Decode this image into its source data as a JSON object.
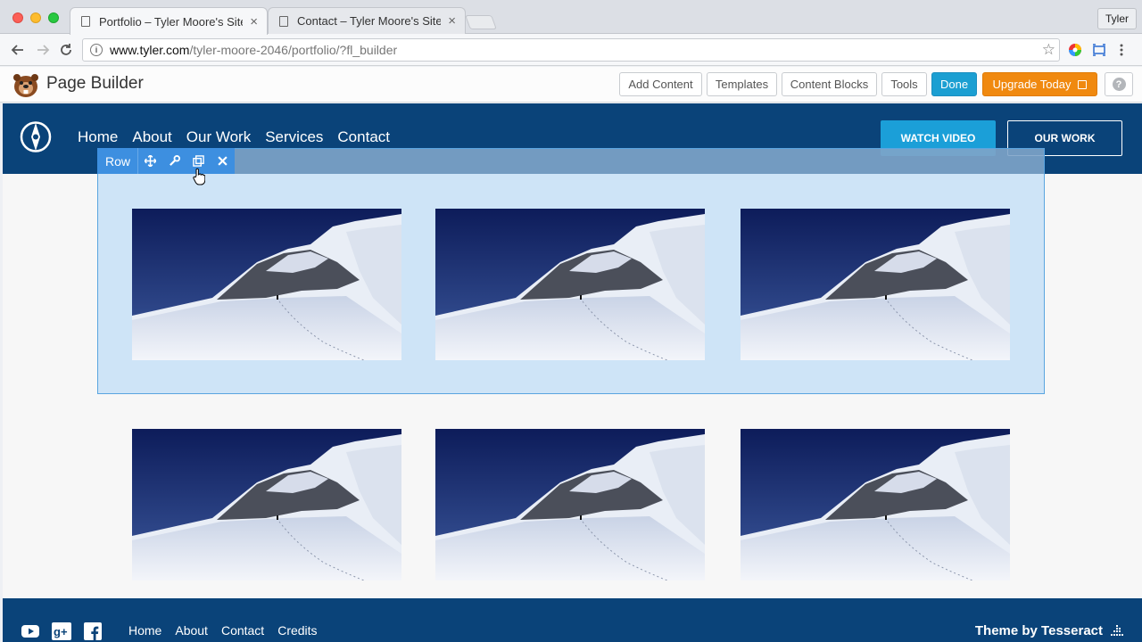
{
  "browser": {
    "tabs": [
      {
        "title": "Portfolio – Tyler Moore's Site",
        "close": "×"
      },
      {
        "title": "Contact – Tyler Moore's Site",
        "close": "×"
      }
    ],
    "profile": "Tyler",
    "url_host": "www.tyler.com",
    "url_path": "/tyler-moore-2046/portfolio/?fl_builder"
  },
  "builder": {
    "title": "Page Builder",
    "buttons": {
      "add_content": "Add Content",
      "templates": "Templates",
      "content_blocks": "Content Blocks",
      "tools": "Tools",
      "done": "Done",
      "upgrade": "Upgrade Today"
    },
    "help": "?"
  },
  "site": {
    "nav": [
      "Home",
      "About",
      "Our Work",
      "Services",
      "Contact"
    ],
    "cta_primary": "WATCH VIDEO",
    "cta_secondary": "OUR WORK"
  },
  "row_toolbar": {
    "label": "Row",
    "icons": [
      "move-icon",
      "wrench-icon",
      "duplicate-icon",
      "close-icon"
    ]
  },
  "gallery": {
    "image_count": 6,
    "image_subject": "snowy-mountain-photo"
  },
  "footer": {
    "social": [
      "youtube-icon",
      "google-plus-icon",
      "facebook-icon"
    ],
    "nav": [
      "Home",
      "About",
      "Contact",
      "Credits"
    ],
    "credit": "Theme by Tesseract"
  },
  "colors": {
    "site_header": "#0a4379",
    "builder_done": "#1b9fd2",
    "builder_upgrade": "#f0890f",
    "row_selection": "#3d8fe0"
  }
}
